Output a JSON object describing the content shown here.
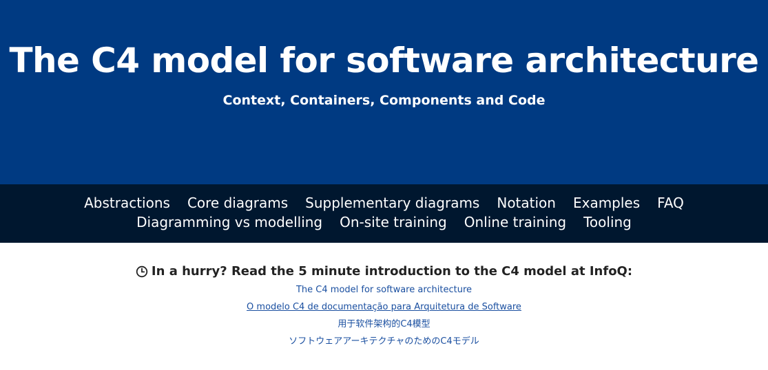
{
  "header": {
    "title": "The C4 model for software architecture",
    "subtitle": "Context, Containers, Components and Code",
    "background_color": "#003a82"
  },
  "nav": {
    "background_color": "#00172f",
    "row1": [
      "Abstractions",
      "Core diagrams",
      "Supplementary diagrams",
      "Notation",
      "Examples",
      "FAQ"
    ],
    "row2": [
      "Diagramming vs modelling",
      "On-site training",
      "Online training",
      "Tooling"
    ]
  },
  "intro": {
    "icon": "clock-icon",
    "heading": "In a hurry? Read the 5 minute introduction to the C4 model at InfoQ:",
    "links": [
      "The C4 model for software architecture",
      "O modelo C4 de documentação para Arquitetura de Software",
      "用于软件架构的C4模型",
      "ソフトウェアアーキテクチャのためのC4モデル"
    ],
    "link_color": "#1a4fa0"
  }
}
